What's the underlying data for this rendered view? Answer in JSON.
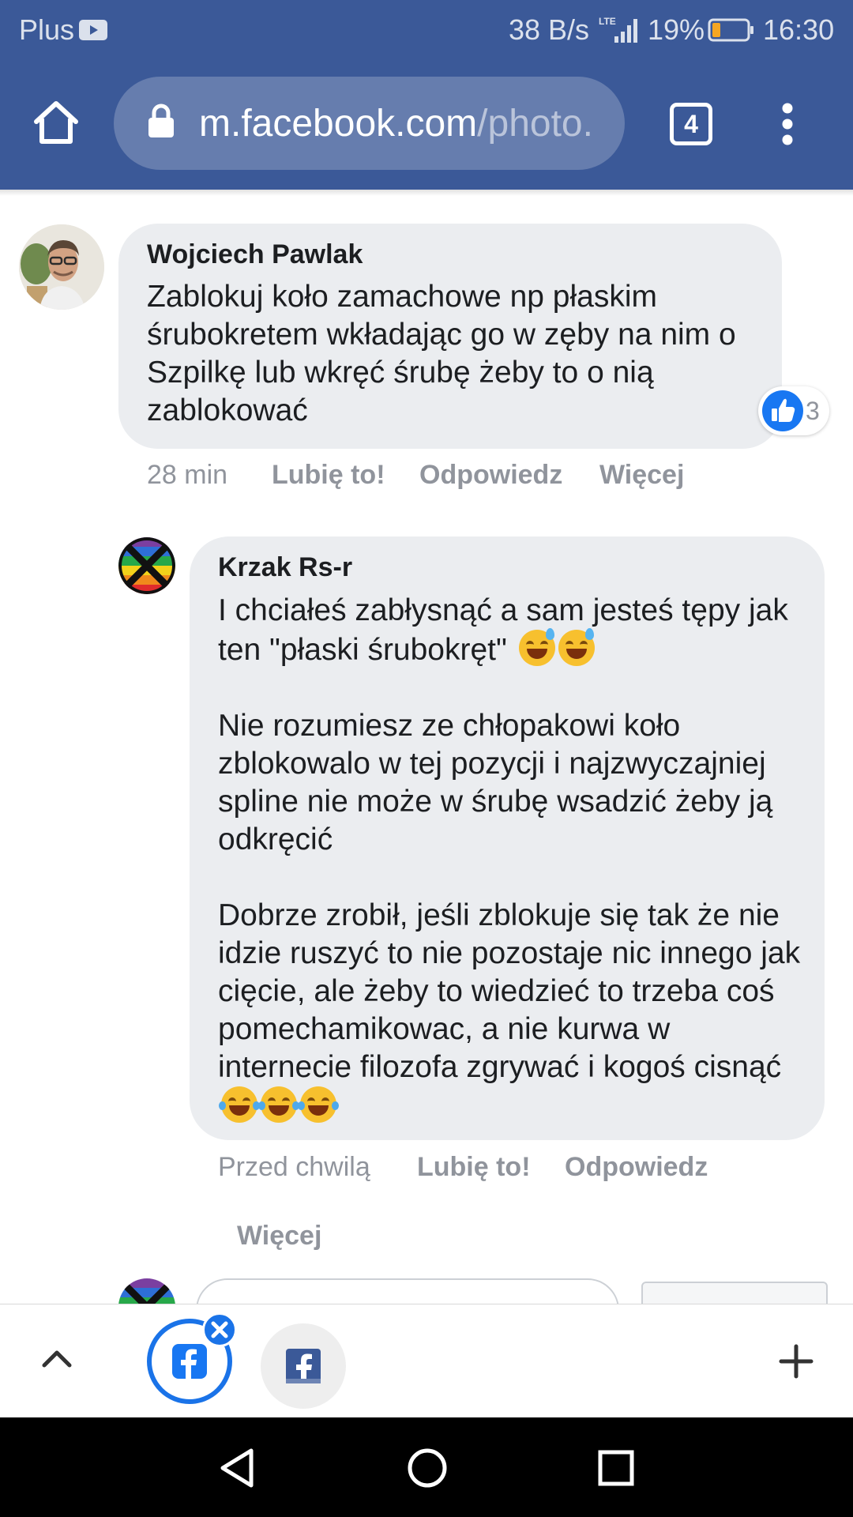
{
  "status_bar": {
    "carrier": "Plus",
    "net_speed": "38 B/s",
    "network_type": "LTE",
    "battery": "19%",
    "time": "16:30"
  },
  "browser": {
    "url_domain": "m.facebook.com",
    "url_path": "/photo.",
    "tab_count": "4"
  },
  "comments": [
    {
      "author": "Wojciech Pawlak",
      "text": "Zablokuj koło zamachowe np płaskim śrubokretem wkładając go w zęby na nim o Szpilkę lub wkręć śrubę żeby to o nią zablokować",
      "time": "28 min",
      "like_label": "Lubię to!",
      "reply_label": "Odpowiedz",
      "more_label": "Więcej",
      "reaction_count": "3"
    },
    {
      "author": "Krzak Rs-r",
      "paragraph1": "I chciałeś zabłysnąć a sam jesteś tępy jak ten \"płaski śrubokręt\"",
      "paragraph2": "Nie rozumiesz ze chłopakowi koło zblokowalo w tej pozycji i najzwyczajniej spline nie może w śrubę wsadzić żeby ją odkręcić",
      "paragraph3": "Dobrze zrobił, jeśli zblokuje się tak że nie idzie ruszyć to nie pozostaje nic innego jak cięcie, ale żeby to wiedzieć to trzeba coś pomechamikowac, a nie kurwa w internecie filozofa zgrywać i kogoś cisnąć",
      "time": "Przed chwilą",
      "like_label": "Lubię to!",
      "reply_label": "Odpowiedz",
      "more_label": "Więcej"
    }
  ],
  "colors": {
    "facebook_blue": "#3b5998",
    "bubble_gray": "#ebedf0",
    "meta_gray": "#90949c",
    "like_blue": "#1877f2"
  },
  "icons": {
    "home": "home-icon",
    "lock": "lock-icon",
    "tabs": "tab-count-icon",
    "menu": "overflow-menu-icon",
    "reaction": "thumbs-up-icon",
    "expand": "chevron-up-icon",
    "close": "close-icon",
    "new_tab": "plus-icon",
    "nav_back": "back-triangle-icon",
    "nav_home": "home-circle-icon",
    "nav_recents": "recents-square-icon"
  }
}
